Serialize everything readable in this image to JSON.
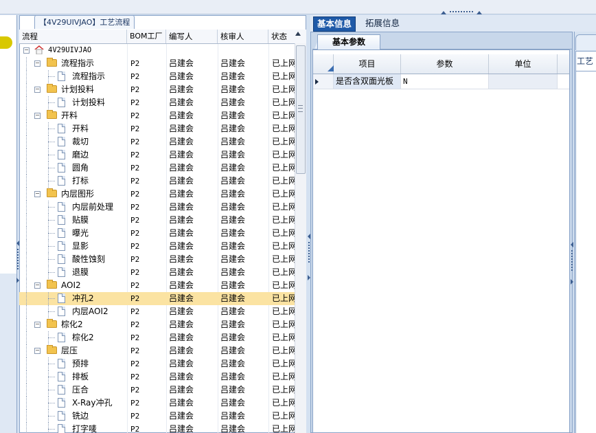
{
  "tree_tab_title": "【4V29UIVJAO】工艺流程",
  "tree_columns": [
    "流程",
    "BOM工厂",
    "编写人",
    "核审人",
    "状态"
  ],
  "tree_rows": [
    {
      "level": 0,
      "type": "root",
      "label": "4V29UIVJAO",
      "bom": "",
      "writer": "",
      "reviewer": "",
      "status": ""
    },
    {
      "level": 1,
      "type": "folder",
      "label": "流程指示",
      "bom": "P2",
      "writer": "吕建会",
      "reviewer": "吕建会",
      "status": "已上网"
    },
    {
      "level": 2,
      "type": "doc",
      "label": "流程指示",
      "bom": "P2",
      "writer": "吕建会",
      "reviewer": "吕建会",
      "status": "已上网"
    },
    {
      "level": 1,
      "type": "folder",
      "label": "计划投料",
      "bom": "P2",
      "writer": "吕建会",
      "reviewer": "吕建会",
      "status": "已上网"
    },
    {
      "level": 2,
      "type": "doc",
      "label": "计划投料",
      "bom": "P2",
      "writer": "吕建会",
      "reviewer": "吕建会",
      "status": "已上网"
    },
    {
      "level": 1,
      "type": "folder",
      "label": "开料",
      "bom": "P2",
      "writer": "吕建会",
      "reviewer": "吕建会",
      "status": "已上网"
    },
    {
      "level": 2,
      "type": "doc",
      "label": "开料",
      "bom": "P2",
      "writer": "吕建会",
      "reviewer": "吕建会",
      "status": "已上网"
    },
    {
      "level": 2,
      "type": "doc",
      "label": "裁切",
      "bom": "P2",
      "writer": "吕建会",
      "reviewer": "吕建会",
      "status": "已上网"
    },
    {
      "level": 2,
      "type": "doc",
      "label": "磨边",
      "bom": "P2",
      "writer": "吕建会",
      "reviewer": "吕建会",
      "status": "已上网"
    },
    {
      "level": 2,
      "type": "doc",
      "label": "圆角",
      "bom": "P2",
      "writer": "吕建会",
      "reviewer": "吕建会",
      "status": "已上网"
    },
    {
      "level": 2,
      "type": "doc",
      "label": "打标",
      "bom": "P2",
      "writer": "吕建会",
      "reviewer": "吕建会",
      "status": "已上网"
    },
    {
      "level": 1,
      "type": "folder",
      "label": "内层图形",
      "bom": "P2",
      "writer": "吕建会",
      "reviewer": "吕建会",
      "status": "已上网"
    },
    {
      "level": 2,
      "type": "doc",
      "label": "内层前处理",
      "bom": "P2",
      "writer": "吕建会",
      "reviewer": "吕建会",
      "status": "已上网"
    },
    {
      "level": 2,
      "type": "doc",
      "label": "贴膜",
      "bom": "P2",
      "writer": "吕建会",
      "reviewer": "吕建会",
      "status": "已上网"
    },
    {
      "level": 2,
      "type": "doc",
      "label": "曝光",
      "bom": "P2",
      "writer": "吕建会",
      "reviewer": "吕建会",
      "status": "已上网"
    },
    {
      "level": 2,
      "type": "doc",
      "label": "显影",
      "bom": "P2",
      "writer": "吕建会",
      "reviewer": "吕建会",
      "status": "已上网"
    },
    {
      "level": 2,
      "type": "doc",
      "label": "酸性蚀刻",
      "bom": "P2",
      "writer": "吕建会",
      "reviewer": "吕建会",
      "status": "已上网"
    },
    {
      "level": 2,
      "type": "doc",
      "label": "退膜",
      "bom": "P2",
      "writer": "吕建会",
      "reviewer": "吕建会",
      "status": "已上网"
    },
    {
      "level": 1,
      "type": "folder",
      "label": "AOI2",
      "bom": "P2",
      "writer": "吕建会",
      "reviewer": "吕建会",
      "status": "已上网"
    },
    {
      "level": 2,
      "type": "doc",
      "label": "冲孔2",
      "bom": "P2",
      "writer": "吕建会",
      "reviewer": "吕建会",
      "status": "已上网",
      "selected": true
    },
    {
      "level": 2,
      "type": "doc",
      "label": "内层AOI2",
      "bom": "P2",
      "writer": "吕建会",
      "reviewer": "吕建会",
      "status": "已上网"
    },
    {
      "level": 1,
      "type": "folder",
      "label": "棕化2",
      "bom": "P2",
      "writer": "吕建会",
      "reviewer": "吕建会",
      "status": "已上网"
    },
    {
      "level": 2,
      "type": "doc",
      "label": "棕化2",
      "bom": "P2",
      "writer": "吕建会",
      "reviewer": "吕建会",
      "status": "已上网"
    },
    {
      "level": 1,
      "type": "folder",
      "label": "层压",
      "bom": "P2",
      "writer": "吕建会",
      "reviewer": "吕建会",
      "status": "已上网"
    },
    {
      "level": 2,
      "type": "doc",
      "label": "预排",
      "bom": "P2",
      "writer": "吕建会",
      "reviewer": "吕建会",
      "status": "已上网"
    },
    {
      "level": 2,
      "type": "doc",
      "label": "排板",
      "bom": "P2",
      "writer": "吕建会",
      "reviewer": "吕建会",
      "status": "已上网"
    },
    {
      "level": 2,
      "type": "doc",
      "label": "压合",
      "bom": "P2",
      "writer": "吕建会",
      "reviewer": "吕建会",
      "status": "已上网"
    },
    {
      "level": 2,
      "type": "doc",
      "label": "X-Ray冲孔",
      "bom": "P2",
      "writer": "吕建会",
      "reviewer": "吕建会",
      "status": "已上网"
    },
    {
      "level": 2,
      "type": "doc",
      "label": "铣边",
      "bom": "P2",
      "writer": "吕建会",
      "reviewer": "吕建会",
      "status": "已上网"
    },
    {
      "level": 2,
      "type": "doc",
      "label": "打字唛",
      "bom": "P2",
      "writer": "吕建会",
      "reviewer": "吕建会",
      "status": "已上网"
    }
  ],
  "info_tabs": [
    "基本信息",
    "拓展信息"
  ],
  "sub_tab": "基本参数",
  "grid_columns": [
    "项目",
    "参数",
    "单位"
  ],
  "grid_rows": [
    {
      "item": "是否含双面光板",
      "param": "N",
      "unit": ""
    }
  ],
  "right_tab_label": "工艺",
  "colors": {
    "accent": "#1f5aa8",
    "selected_row": "#fbe3a2",
    "folder": "#f2c34e",
    "border": "#8aa4c8"
  }
}
